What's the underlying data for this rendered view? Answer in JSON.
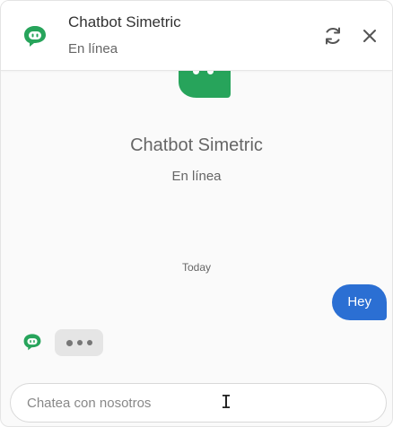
{
  "colors": {
    "brand_green": "#27a45b",
    "user_bubble": "#2b6fd3",
    "typing_bubble": "#e5e5e5"
  },
  "header": {
    "title": "Chatbot Simetric",
    "status": "En línea",
    "icons": {
      "bot": "bot-icon",
      "refresh": "refresh-icon",
      "close": "close-icon"
    }
  },
  "intro": {
    "title": "Chatbot Simetric",
    "status": "En línea"
  },
  "conversation": {
    "date_separator": "Today",
    "messages": [
      {
        "sender": "user",
        "text": "Hey"
      }
    ],
    "bot_typing": true
  },
  "composer": {
    "placeholder": "Chatea con nosotros",
    "value": ""
  }
}
